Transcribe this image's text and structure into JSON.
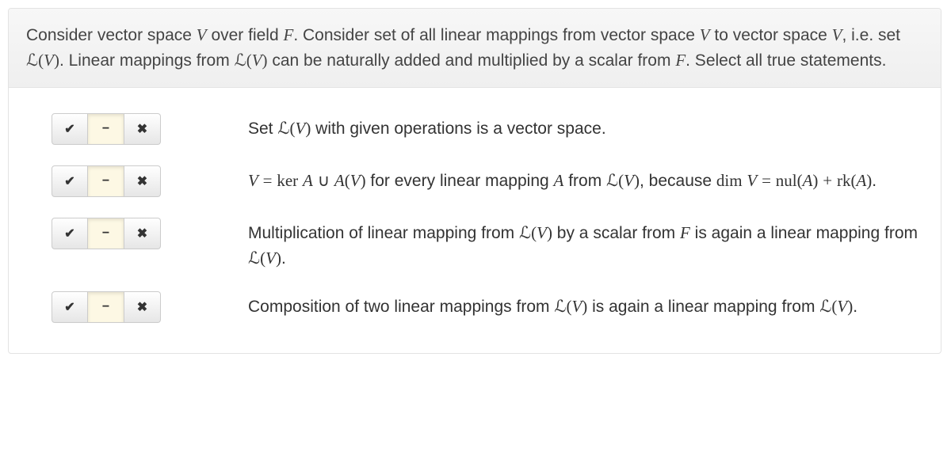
{
  "question": {
    "text": ""
  },
  "controls": {
    "yes_glyph": "✔",
    "neutral_glyph": "−",
    "no_glyph": "✖"
  },
  "answers": [
    {
      "selected": "neutral"
    },
    {
      "selected": "neutral"
    },
    {
      "selected": "neutral"
    },
    {
      "selected": "neutral"
    }
  ]
}
